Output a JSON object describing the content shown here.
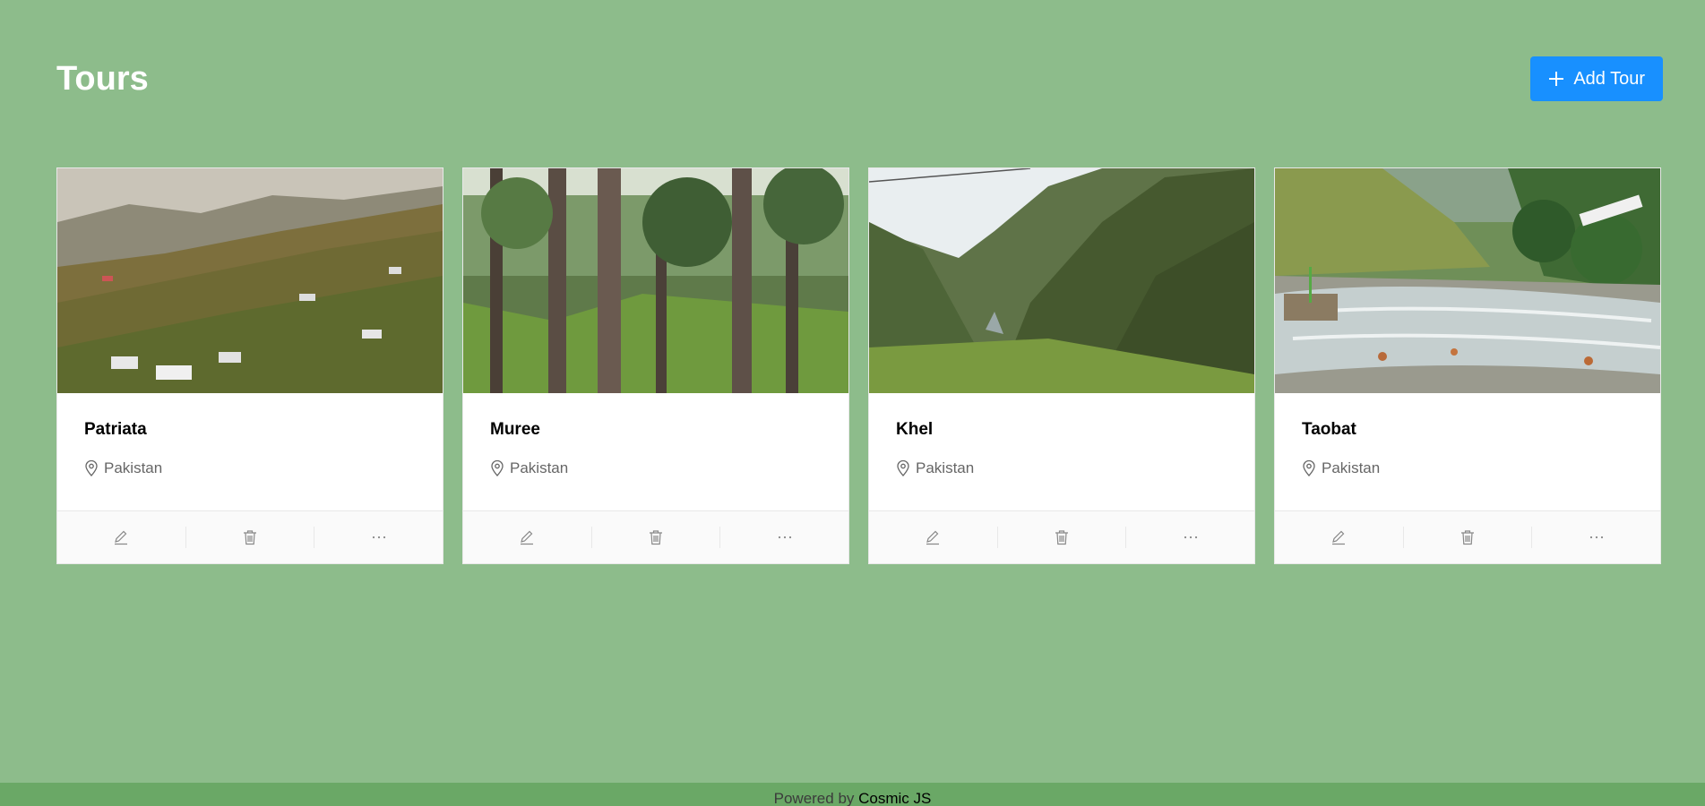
{
  "header": {
    "title": "Tours",
    "add_button_label": "Add Tour",
    "add_button_icon": "plus-icon"
  },
  "tours": [
    {
      "name": "Patriata",
      "location": "Pakistan",
      "image": "hillside-village-photo"
    },
    {
      "name": "Muree",
      "location": "Pakistan",
      "image": "pine-forest-photo"
    },
    {
      "name": "Khel",
      "location": "Pakistan",
      "image": "mountain-valley-photo"
    },
    {
      "name": "Taobat",
      "location": "Pakistan",
      "image": "river-photo"
    }
  ],
  "card_actions": [
    {
      "icon": "edit-icon"
    },
    {
      "icon": "delete-icon"
    },
    {
      "icon": "ellipsis-icon"
    }
  ],
  "footer": {
    "prefix": "Powered by",
    "link_label": "Cosmic JS"
  },
  "colors": {
    "background": "#8dbc8b",
    "primary": "#1890ff",
    "footer": "#6aa866"
  }
}
